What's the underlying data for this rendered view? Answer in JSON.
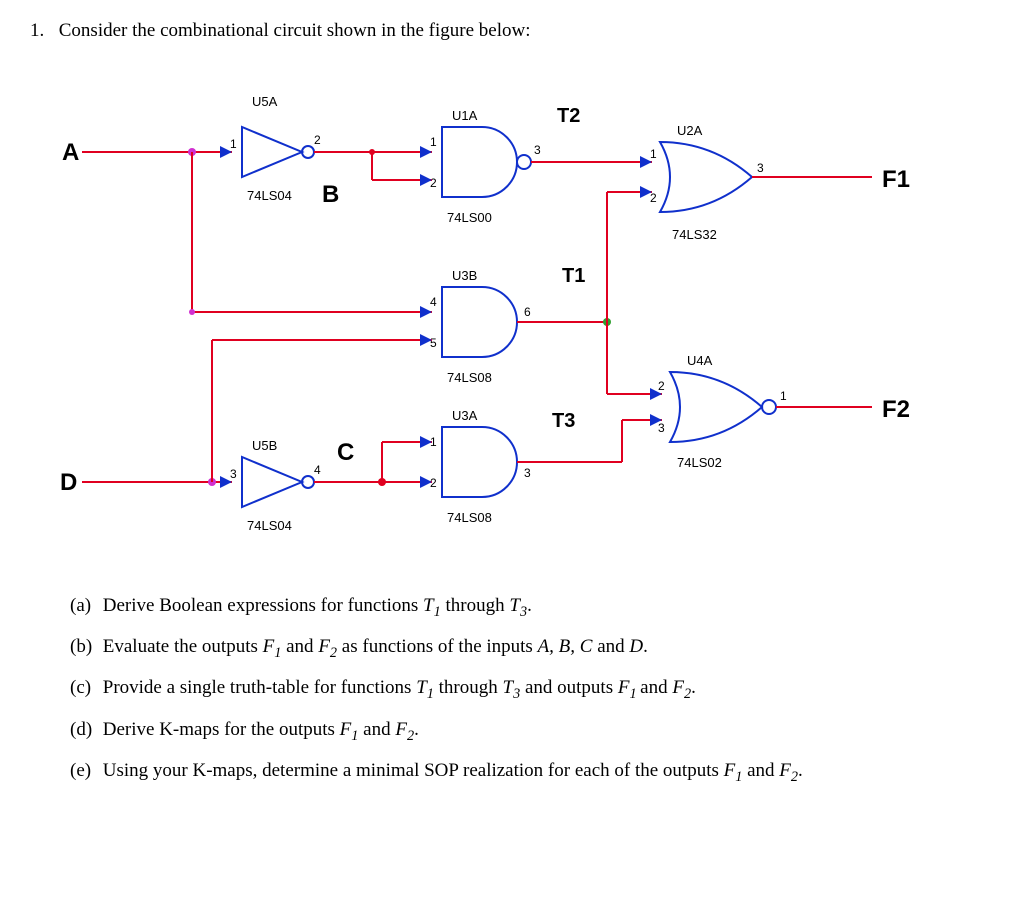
{
  "question": {
    "number": "1.",
    "intro": "Consider the combinational circuit shown in the figure below:"
  },
  "circuit": {
    "inputs": {
      "A": "A",
      "B": "B",
      "C": "C",
      "D": "D"
    },
    "signals": {
      "T1": "T1",
      "T2": "T2",
      "T3": "T3"
    },
    "outputs": {
      "F1": "F1",
      "F2": "F2"
    },
    "gates": {
      "U5A": {
        "ref": "U5A",
        "part": "74LS04",
        "pins": [
          "1",
          "2"
        ]
      },
      "U5B": {
        "ref": "U5B",
        "part": "74LS04",
        "pins": [
          "3",
          "4"
        ]
      },
      "U1A": {
        "ref": "U1A",
        "part": "74LS00",
        "pins": [
          "1",
          "2",
          "3"
        ]
      },
      "U3B": {
        "ref": "U3B",
        "part": "74LS08",
        "pins": [
          "4",
          "5",
          "6"
        ]
      },
      "U3A": {
        "ref": "U3A",
        "part": "74LS08",
        "pins": [
          "1",
          "2",
          "3"
        ]
      },
      "U2A": {
        "ref": "U2A",
        "part": "74LS32",
        "pins": [
          "1",
          "2",
          "3"
        ]
      },
      "U4A": {
        "ref": "U4A",
        "part": "74LS02",
        "pins": [
          "1",
          "2",
          "3"
        ]
      }
    }
  },
  "parts": {
    "a": {
      "label": "(a)",
      "text_pre": "Derive Boolean expressions for functions ",
      "T1": "T",
      "sub1": "1",
      "mid": " through ",
      "T3": "T",
      "sub3": "3",
      "post": "."
    },
    "b": {
      "label": "(b)",
      "text_pre": "Evaluate the outputs ",
      "F1": "F",
      "s1": "1",
      "and": " and ",
      "F2": "F",
      "s2": "2",
      "mid": " as functions of the inputs ",
      "vars": "A, B, C",
      "and2": " and ",
      "D": "D",
      "post": "."
    },
    "c": {
      "label": "(c)",
      "text_pre": "Provide a single truth-table for functions ",
      "T1": "T",
      "s1": "1",
      "mid": " through ",
      "T3": "T",
      "s3": "3",
      "and": " and outputs ",
      "F1": "F",
      "sf1": "1 ",
      "and2": "and ",
      "F2": "F",
      "sf2": "2",
      "post": "."
    },
    "d": {
      "label": "(d)",
      "text_pre": "Derive K-maps for the outputs ",
      "F1": "F",
      "s1": "1",
      "and": " and ",
      "F2": "F",
      "s2": "2",
      "post": "."
    },
    "e": {
      "label": "(e)",
      "text_pre": "Using your K-maps, determine a minimal SOP realization for each of the outputs ",
      "F1": "F",
      "s1": "1",
      "and": " and ",
      "F2": "F",
      "s2": "2",
      "post": "."
    }
  }
}
